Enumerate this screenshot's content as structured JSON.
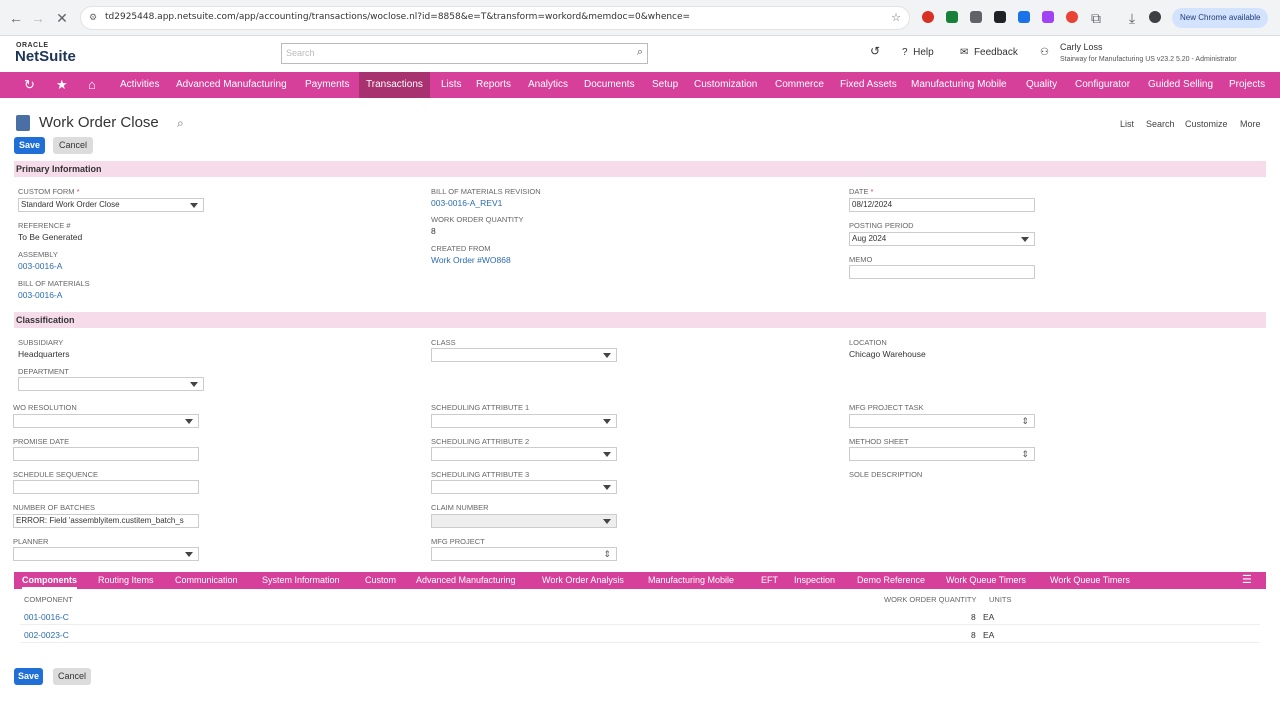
{
  "browser": {
    "url": "td2925448.app.netsuite.com/app/accounting/transactions/woclose.nl?id=8858&e=T&transform=workord&memdoc=0&whence=",
    "new_chrome": "New Chrome available"
  },
  "header": {
    "oracle": "ORACLE",
    "netsuite": "NetSuite",
    "search_placeholder": "Search",
    "help": "Help",
    "feedback": "Feedback",
    "user_name": "Carly Loss",
    "user_role": "Stairway for Manufacturing US v23.2 5.20 - Administrator"
  },
  "nav": {
    "items": [
      "Activities",
      "Advanced Manufacturing",
      "Payments",
      "Transactions",
      "Lists",
      "Reports",
      "Analytics",
      "Documents",
      "Setup",
      "Customization",
      "Commerce",
      "Fixed Assets",
      "Manufacturing Mobile",
      "Quality",
      "Configurator",
      "Guided Selling",
      "Projects"
    ],
    "selected": "Transactions"
  },
  "page": {
    "title": "Work Order Close",
    "save": "Save",
    "cancel": "Cancel",
    "links": [
      "List",
      "Search",
      "Customize",
      "More"
    ]
  },
  "primary": {
    "section": "Primary Information",
    "custom_form_label": "CUSTOM FORM",
    "custom_form_value": "Standard Work Order Close",
    "reference_label": "REFERENCE #",
    "reference_value": "To Be Generated",
    "assembly_label": "ASSEMBLY",
    "assembly_value": "003-0016-A",
    "bom_label": "BILL OF MATERIALS",
    "bom_value": "003-0016-A",
    "bom_rev_label": "BILL OF MATERIALS REVISION",
    "bom_rev_value": "003-0016-A_REV1",
    "wo_qty_label": "WORK ORDER QUANTITY",
    "wo_qty_value": "8",
    "created_from_label": "CREATED FROM",
    "created_from_value": "Work Order #WO868",
    "date_label": "DATE",
    "date_value": "08/12/2024",
    "posting_period_label": "POSTING PERIOD",
    "posting_period_value": "Aug 2024",
    "memo_label": "MEMO"
  },
  "classification": {
    "section": "Classification",
    "subsidiary_label": "SUBSIDIARY",
    "subsidiary_value": "Headquarters",
    "department_label": "DEPARTMENT",
    "class_label": "CLASS",
    "location_label": "LOCATION",
    "location_value": "Chicago Warehouse",
    "wo_resolution_label": "WO RESOLUTION",
    "promise_date_label": "PROMISE DATE",
    "schedule_sequence_label": "SCHEDULE SEQUENCE",
    "number_of_batches_label": "NUMBER OF BATCHES",
    "number_of_batches_value": "ERROR: Field 'assemblyitem.custitem_batch_s",
    "planner_label": "PLANNER",
    "sched_attr1_label": "SCHEDULING ATTRIBUTE 1",
    "sched_attr2_label": "SCHEDULING ATTRIBUTE 2",
    "sched_attr3_label": "SCHEDULING ATTRIBUTE 3",
    "claim_number_label": "CLAIM NUMBER",
    "mfg_project_label": "MFG PROJECT",
    "mfg_project_task_label": "MFG PROJECT TASK",
    "method_sheet_label": "METHOD SHEET",
    "sole_description_label": "SOLE DESCRIPTION"
  },
  "subtabs": {
    "items": [
      "Components",
      "Routing Items",
      "Communication",
      "System Information",
      "Custom",
      "Advanced Manufacturing",
      "Work Order Analysis",
      "Manufacturing Mobile",
      "EFT",
      "Inspection",
      "Demo Reference",
      "Work Queue Timers",
      "Work Queue Timers"
    ],
    "selected": "Components"
  },
  "components": {
    "headers": {
      "component": "COMPONENT",
      "qty": "WORK ORDER QUANTITY",
      "units": "UNITS"
    },
    "rows": [
      {
        "component": "001-0016-C",
        "qty": "8",
        "units": "EA"
      },
      {
        "component": "002-0023-C",
        "qty": "8",
        "units": "EA"
      }
    ]
  },
  "colors": {
    "nav": "#d6409a",
    "nav_selected": "#a8316f",
    "section": "#f6dcea",
    "save": "#1f6fd6"
  }
}
